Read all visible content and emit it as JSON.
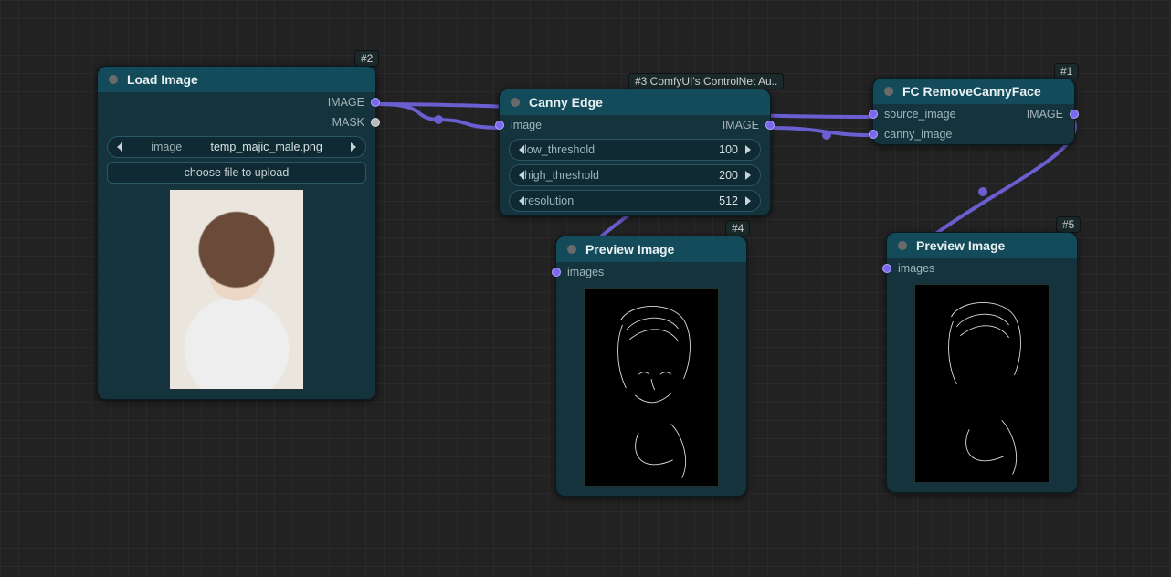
{
  "nodes": {
    "load_image": {
      "id_badge": "#2",
      "title": "Load Image",
      "outputs": {
        "image": "IMAGE",
        "mask": "MASK"
      },
      "image_widget": {
        "label": "image",
        "value": "temp_majic_male.png"
      },
      "upload_button": "choose file to upload"
    },
    "canny_edge": {
      "id_badge": "#3 ComfyUI's ControlNet Au..",
      "title": "Canny Edge",
      "inputs": {
        "image": "image"
      },
      "outputs": {
        "image": "IMAGE"
      },
      "low_threshold": {
        "label": "low_threshold",
        "value": "100"
      },
      "high_threshold": {
        "label": "high_threshold",
        "value": "200"
      },
      "resolution": {
        "label": "resolution",
        "value": "512"
      }
    },
    "remove_canny_face": {
      "id_badge": "#1",
      "title": "FC RemoveCannyFace",
      "inputs": {
        "source_image": "source_image",
        "canny_image": "canny_image"
      },
      "outputs": {
        "image": "IMAGE"
      }
    },
    "preview4": {
      "id_badge": "#4",
      "title": "Preview Image",
      "inputs": {
        "images": "images"
      }
    },
    "preview5": {
      "id_badge": "#5",
      "title": "Preview Image",
      "inputs": {
        "images": "images"
      }
    }
  }
}
